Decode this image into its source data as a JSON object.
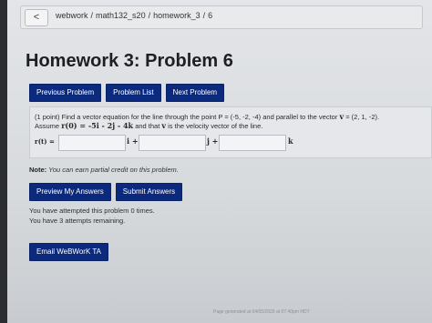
{
  "breadcrumb": {
    "back_glyph": "<",
    "items": [
      "webwork",
      "math132_s20",
      "homework_3",
      "6"
    ],
    "separator": "/"
  },
  "page_title": "Homework 3: Problem 6",
  "nav": {
    "previous": "Previous Problem",
    "list": "Problem List",
    "next": "Next Problem"
  },
  "problem": {
    "points": "(1 point)",
    "line1_text": "Find a vector equation for the line through the point P = (-5, -2, -4) and parallel to the vector",
    "vector_symbol": "v",
    "vector_value": "= (2, 1, -2).",
    "line2_prefix": "Assume",
    "line2_math": "r(0) = -5i - 2j - 4k",
    "line2_mid": "and that",
    "line2_symbol": "v",
    "line2_suffix": "is the velocity vector of the line.",
    "answer_label": "r(t) =",
    "units": [
      "i +",
      "j +",
      "k"
    ]
  },
  "note": {
    "label": "Note:",
    "text": "You can earn partial credit on this problem."
  },
  "actions": {
    "preview": "Preview My Answers",
    "submit": "Submit Answers"
  },
  "attempts": {
    "line1": "You have attempted this problem 0 times.",
    "line2": "You have 3 attempts remaining."
  },
  "email_button": "Email WeBWorK TA",
  "footer": "Page generated at 04/05/2020 at 07:40pm HDT",
  "colors": {
    "button_bg": "#0c2a7d",
    "button_text": "#ffffff"
  }
}
